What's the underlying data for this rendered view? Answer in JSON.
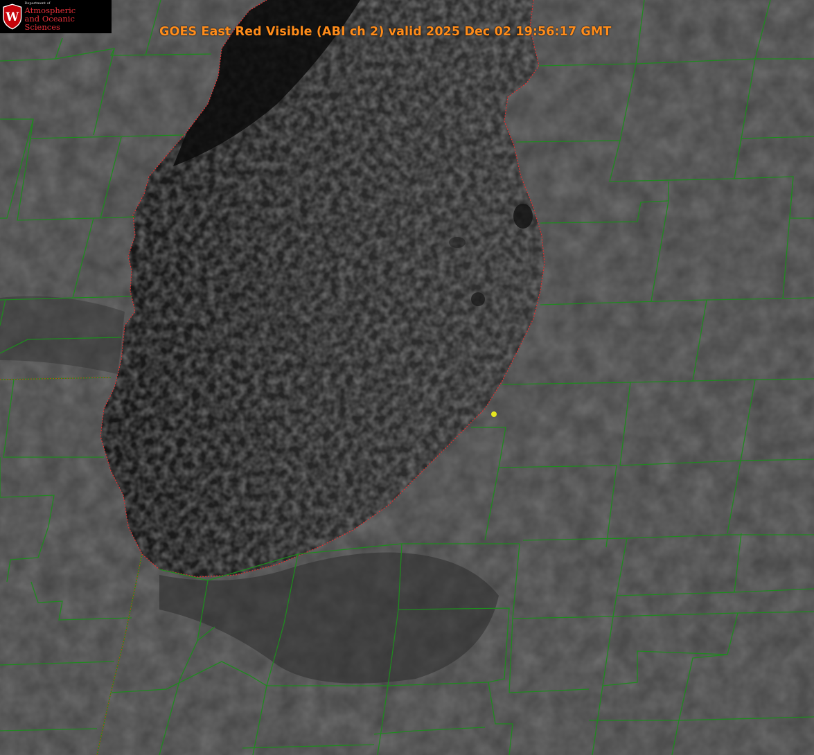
{
  "title": "GOES East Red Visible (ABI ch 2) valid 2025 Dec 02 19:56:17 GMT",
  "logo": {
    "letter": "W",
    "dept": "Department of",
    "line1": "Atmospheric",
    "line2": "and Oceanic Sciences"
  },
  "icons": {
    "logo": "uw-shield-icon",
    "marker": "yellow-dot-marker-icon"
  },
  "colors": {
    "title": "#ff8c1a",
    "county_lines": "#1f8a1f",
    "shoreline": "#e03030",
    "marker": "#e6e620",
    "logo_text": "#e8303a",
    "logo_shield": "#c5050c"
  }
}
